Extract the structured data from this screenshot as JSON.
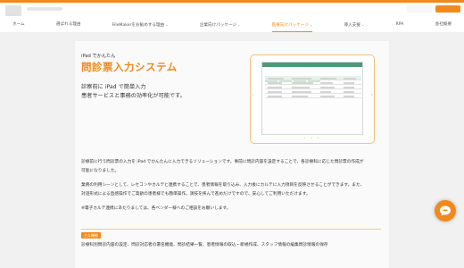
{
  "nav": {
    "items": [
      {
        "label": "ホーム",
        "dropdown": false
      },
      {
        "label": "選ばれる理由",
        "dropdown": false
      },
      {
        "label": "FileMakerをお勧めする理由",
        "dropdown": true
      },
      {
        "label": "企業向けパッケージ",
        "dropdown": true
      },
      {
        "label": "医療向けパッケージ",
        "dropdown": true,
        "active": true
      },
      {
        "label": "導入支援",
        "dropdown": true
      },
      {
        "label": "RPA",
        "dropdown": false
      },
      {
        "label": "会社概要",
        "dropdown": false
      }
    ]
  },
  "hero": {
    "subtitle": "iPad でかんたん",
    "title": "問診票入力システム",
    "lead_line1": "診察前に iPad で簡単入力",
    "lead_line2": "患者サービスと事務の効率化が可能です。"
  },
  "description": {
    "p1_line1": "診療前に行う問診票の入力を iPad でかんたんに入力できるソリューションです。事前に問診内容を設定することで、各診療科に応じた問診票の作成が",
    "p1_line2": "可能になりました。",
    "p2_line1": "業務の利用シーンとして、レセコンやカルテと連携することで、患者情報を取り込み、入力後にカルテに入力項目を反映させることができます。また、",
    "p2_line2": "対話形式による直感操作でご高齢の患者様でも簡単操作。演技を挟んで進めだけですので、安心してご利用いただけます。",
    "note": "※電子カルテ連携にあたりましては、各ベンダー様へのご相談をお願いします。"
  },
  "feature_section": {
    "badge": "主な機能",
    "text": "診療科別問診内容の設定、問診対応者の署名機能、問診結果一覧、患者情報の取込・新規作成、スタッフ情報の編集問診情報の保存"
  },
  "colors": {
    "accent": "#f08a1c",
    "screen_header": "#4c9a78"
  },
  "icons": {
    "chat": "chat-bubble-icon",
    "carousel_prev": "chevron-left-icon",
    "carousel_next": "chevron-right-icon"
  }
}
